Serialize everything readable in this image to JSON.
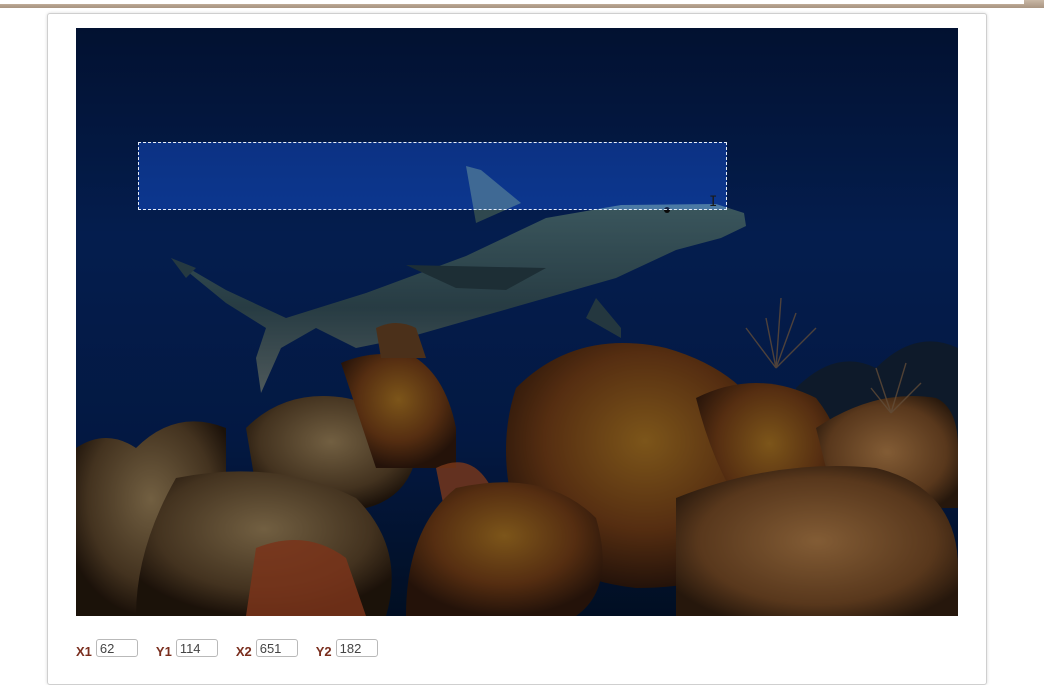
{
  "image": {
    "description_icon": "shark-reef-photo-icon"
  },
  "crop": {
    "x1_label": "X1",
    "y1_label": "Y1",
    "x2_label": "X2",
    "y2_label": "Y2",
    "x1": "62",
    "y1": "114",
    "x2": "651",
    "y2": "182"
  },
  "colors": {
    "label": "#7a2e1e",
    "water": "#06245f",
    "selection_fill": "#1e50c8"
  }
}
